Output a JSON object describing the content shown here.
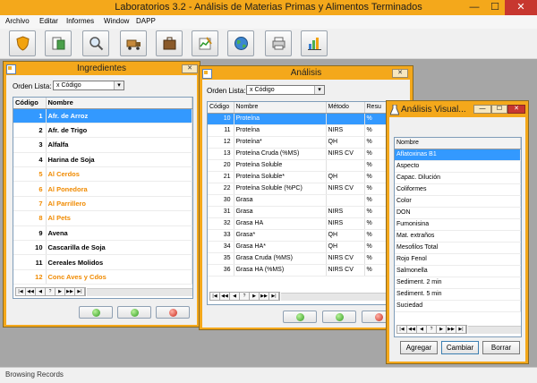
{
  "app": {
    "title": "Laboratorios 3.2 - Análisis de Materias Primas y Alimentos Terminados",
    "minimize": "—",
    "maximize": "☐",
    "close": "✕",
    "accent": "#f4a81b",
    "status": "Browsing Records"
  },
  "menu": [
    "Archivo",
    "Editar",
    "Informes",
    "Window",
    "DAPP"
  ],
  "toolbar": [
    "shield-icon",
    "document-icon",
    "search-icon",
    "truck-icon",
    "briefcase-icon",
    "chart-pen-icon",
    "globe-icon",
    "printer-icon",
    "bar-chart-icon"
  ],
  "ingredientes": {
    "title": "Ingredientes",
    "close": "✕",
    "orden_label": "Orden Lista:",
    "orden_value": "x Código",
    "columns": [
      "Código",
      "Nombre"
    ],
    "rows": [
      {
        "code": "1",
        "name": "Afr. de Arroz",
        "state": "selected"
      },
      {
        "code": "2",
        "name": "Afr. de Trigo",
        "state": "normal"
      },
      {
        "code": "3",
        "name": "Alfalfa",
        "state": "normal"
      },
      {
        "code": "4",
        "name": "Harina de Soja",
        "state": "normal"
      },
      {
        "code": "5",
        "name": "Al Cerdos",
        "state": "orange"
      },
      {
        "code": "6",
        "name": "Al Ponedora",
        "state": "orange"
      },
      {
        "code": "7",
        "name": "Al Parrillero",
        "state": "orange"
      },
      {
        "code": "8",
        "name": "Al Pets",
        "state": "orange"
      },
      {
        "code": "9",
        "name": "Avena",
        "state": "normal"
      },
      {
        "code": "10",
        "name": "Cascarilla de Soja",
        "state": "normal"
      },
      {
        "code": "11",
        "name": "Cereales Molidos",
        "state": "normal"
      },
      {
        "code": "12",
        "name": "Conc Aves y Cdos",
        "state": "orange"
      }
    ],
    "nav": [
      "|◀",
      "◀◀",
      "◀",
      "?",
      "▶",
      "▶▶",
      "▶|"
    ]
  },
  "analisis": {
    "title": "Análisis",
    "close": "✕",
    "orden_label": "Orden Lista:",
    "orden_value": "x Código",
    "columns": [
      "Código",
      "Nombre",
      "Método",
      "Resu"
    ],
    "rows": [
      {
        "code": "10",
        "name": "Proteína",
        "method": "",
        "res": "%",
        "state": "selected"
      },
      {
        "code": "11",
        "name": "Proteína",
        "method": "NIRS",
        "res": "%",
        "state": "normal"
      },
      {
        "code": "12",
        "name": "Proteína*",
        "method": "QH",
        "res": "%",
        "state": "normal"
      },
      {
        "code": "13",
        "name": "Proteína Cruda (%MS)",
        "method": "NIRS CV",
        "res": "%",
        "state": "normal"
      },
      {
        "code": "20",
        "name": "Proteína Soluble",
        "method": "",
        "res": "%",
        "state": "normal"
      },
      {
        "code": "21",
        "name": "Proteína Soluble*",
        "method": "QH",
        "res": "%",
        "state": "normal"
      },
      {
        "code": "22",
        "name": "Proteína Soluble (%PC)",
        "method": "NIRS CV",
        "res": "%",
        "state": "normal"
      },
      {
        "code": "30",
        "name": "Grasa",
        "method": "",
        "res": "%",
        "state": "normal"
      },
      {
        "code": "31",
        "name": "Grasa",
        "method": "NIRS",
        "res": "%",
        "state": "normal"
      },
      {
        "code": "32",
        "name": "Grasa HA",
        "method": "NIRS",
        "res": "%",
        "state": "normal"
      },
      {
        "code": "33",
        "name": "Grasa*",
        "method": "QH",
        "res": "%",
        "state": "normal"
      },
      {
        "code": "34",
        "name": "Grasa HA*",
        "method": "QH",
        "res": "%",
        "state": "normal"
      },
      {
        "code": "35",
        "name": "Grasa Cruda (%MS)",
        "method": "NIRS CV",
        "res": "%",
        "state": "normal"
      },
      {
        "code": "36",
        "name": "Grasa HA (%MS)",
        "method": "NIRS CV",
        "res": "%",
        "state": "normal"
      }
    ],
    "nav": [
      "|◀",
      "◀◀",
      "◀",
      "?",
      "▶",
      "▶▶",
      "▶|"
    ]
  },
  "visual": {
    "title": "Análisis Visual...",
    "minimize": "—",
    "maximize": "☐",
    "close": "✕",
    "column": "Nombre",
    "rows": [
      {
        "name": "Aflatoxinas B1",
        "state": "selected"
      },
      {
        "name": "Aspecto",
        "state": "normal"
      },
      {
        "name": "Capac. Dilución",
        "state": "normal"
      },
      {
        "name": "Coliformes",
        "state": "normal"
      },
      {
        "name": "Color",
        "state": "normal"
      },
      {
        "name": "DON",
        "state": "normal"
      },
      {
        "name": "Fumonisina",
        "state": "normal"
      },
      {
        "name": "Mat. extraños",
        "state": "normal"
      },
      {
        "name": "Mesofilos Total",
        "state": "normal"
      },
      {
        "name": "Rojo Fenol",
        "state": "normal"
      },
      {
        "name": "Salmonella",
        "state": "normal"
      },
      {
        "name": "Sediment. 2 min",
        "state": "normal"
      },
      {
        "name": "Sediment. 5 min",
        "state": "normal"
      },
      {
        "name": "Suciedad",
        "state": "normal"
      }
    ],
    "nav": [
      "|◀",
      "◀◀",
      "◀",
      "?",
      "▶",
      "▶▶",
      "▶|"
    ],
    "buttons": {
      "agregar": "Agregar",
      "cambiar": "Cambiar",
      "borrar": "Borrar"
    }
  }
}
